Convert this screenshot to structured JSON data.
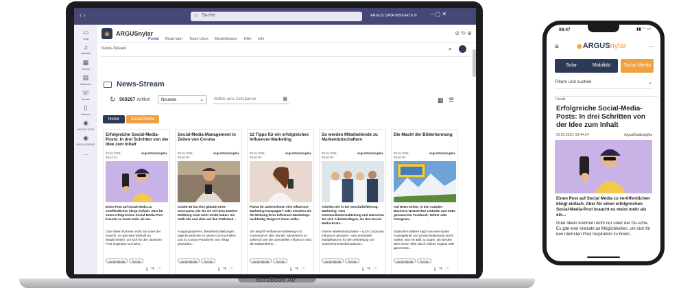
{
  "teams": {
    "search_placeholder": "Suche",
    "window_title": "ARGUS DATA INSIGHTS ®",
    "rail": [
      {
        "label": "Chat",
        "icon": "chat-icon"
      },
      {
        "label": "Aktivität",
        "icon": "bell-icon"
      },
      {
        "label": "Teams",
        "icon": "teams-icon"
      },
      {
        "label": "Kalender",
        "icon": "calendar-icon"
      },
      {
        "label": "Anrufe",
        "icon": "phone-icon"
      },
      {
        "label": "Dateien",
        "icon": "file-icon"
      },
      {
        "label": "ARGUS DATA",
        "icon": "eye-icon"
      },
      {
        "label": "ARGUS NEWS",
        "icon": "eye-icon"
      }
    ]
  },
  "app": {
    "name": "ARGUSnylar",
    "tabs": [
      "Portal",
      "Read later",
      "Team Likes",
      "Einstellungen",
      "Hilfe",
      "Info"
    ]
  },
  "content": {
    "breadcrumb": "News-Stream",
    "title": "News-Stream",
    "article_count": "569287",
    "article_suffix": "Artikel",
    "sort_value": "Neueste",
    "date_placeholder": "Wähle eine Zeitspanne",
    "pills": [
      "Home",
      "Social Media"
    ]
  },
  "cards": [
    {
      "title": "Erfolgreiche Social-Media-Posts: In drei Schritten von der Idee zum Inhalt",
      "date": "03.02.2022,",
      "time": "09:44:24",
      "source": "ArgusDataInsights",
      "lead": "Einen Post auf Social Media zu veröffentlichen klingt einfach. Aber für einen erfolgreichen Social-Media-Post braucht es meist mehr als ein...",
      "body": "Gute Ideen kommen nicht nur unter der Dusche. Es gibt eine Vielzahl an Möglichkeiten, um sich für den nächsten Post Inspiration zu holen...",
      "tags": [
        "Social Media",
        "Trends"
      ]
    },
    {
      "title": "Social-Media-Management in Zeiten von Corona",
      "date": "08.02.2022,",
      "time": "09:40:06",
      "source": "ArgusDataInsights",
      "lead": "COVID-19 hat eine globale Krise verursacht, wie wir sie seit dem Zweiten Weltkrieg nicht mehr erlebt haben. Sie stellt alle und alles auf den Prüfstand...",
      "body": "Ausgangssperren, Besteheschließungen, tägliche Berichte zu neuen Corona-Fällen und zu Corona-Pandemie zum Alltag geworden...",
      "tags": [
        "Social Media",
        "Trends"
      ]
    },
    {
      "title": "12 Tipps für ein erfolgreiches Influencer-Marketing",
      "date": "08.02.2022,",
      "time": "09:40:06",
      "source": "ArgusDataInsights",
      "lead": "Planst Ihr Unternehmen eine Influencer-Marketing-Kampagne? Oder möchten Sie die Wirkung Ihres Influencer-Marketings nachhaltig steigern? Dann sollte...",
      "body": "Der Begriff »Influencer-Marketing« ist momentan in aller Munde. Mindestens so zahlreich wie die potentiellen Influencer sind die Stolpersteine...",
      "tags": [
        "Social Media",
        "Trends"
      ]
    },
    {
      "title": "So werden Mitarbeitende zu Markenbotschaftern",
      "date": "08.02.2022,",
      "time": "09:40:06",
      "source": "ArgusDataInsights",
      "lead": "Arbeiten Sie in der Geschäftsführung, Marketing- oder Kommunikationsabteilung und wünschen Sie sich Arbeitskollegen, die Ihre Social-Media-Posts...",
      "body": "Interne Markenbotschafter – auch Corporate Influencer genannt – sind potentielle Multiplikatoren für die Verbreitung von Unternehmensinformationen...",
      "tags": [
        "Social Media",
        "Trends"
      ]
    },
    {
      "title": "Die Macht der Bilderkennung",
      "date": "08.02.2022,",
      "time": "09:40:06",
      "source": "ArgusDataInsights",
      "lead": "Auf News-seiten, in den sozialen Business-Netzwerken LinkedIn und XING genauso bei Facebook, Twitter oder Instagram...",
      "body": "Statischen Bildern sagt man eine starke Aussagekraft und grosse Bedeutung durch Stärke, was ein Bild zu sagen, als werden aber immer öfter durch Videos ergänzt oder gar ersetzt...",
      "tags": [
        "Social Media",
        "Trends"
      ]
    }
  ],
  "laptop": {
    "brand": "NoteBook Air"
  },
  "phone": {
    "time": "08:47",
    "logo_part1": "ARGUS",
    "logo_part2": "nylar",
    "tabs": [
      "Solar",
      "Mobilität",
      "Social Media"
    ],
    "filter": "Filtern und suchen",
    "trend_label": "Trends",
    "title": "Erfolgreiche Social-Media-Posts: In drei Schritten von der Idee zum Inhalt",
    "date": "03.02.2022, 09:44:24",
    "source": "ArgusDataInsights",
    "lead": "Einen Post auf Social Media zu veröffentlichen klingt einfach. Aber für einen erfolgreichen Social-Media-Post braucht es meist mehr als ein...",
    "body": "Gute Ideen kommen nicht nur unter der Du-sche. Es gibt eine Vielzahl an Möglichkeiten, um sich für den nächsten Post Inspiration zu holen..."
  },
  "colors": {
    "navy": "#2d3a55",
    "orange": "#f0a040",
    "teams_purple": "#464775"
  }
}
